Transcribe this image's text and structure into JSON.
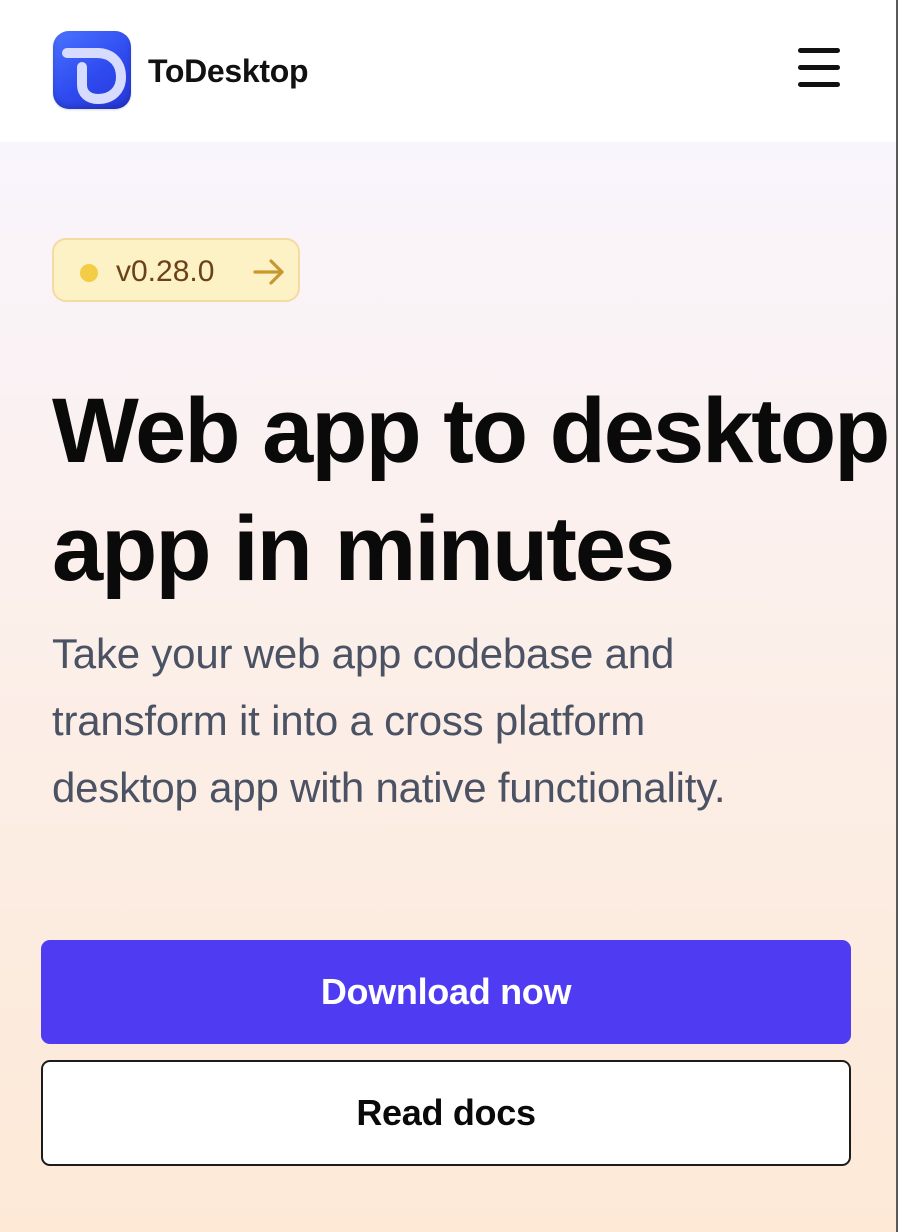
{
  "header": {
    "brand_name": "ToDesktop",
    "logo_icon": "todesktop-logo-icon",
    "menu_icon": "hamburger-menu-icon"
  },
  "badge": {
    "version": "v0.28.0",
    "arrow_icon": "arrow-right-icon"
  },
  "hero": {
    "headline_line1": "Web app to desktop",
    "headline_line2": "app in minutes",
    "subheading_line1": "Take your web app codebase and",
    "subheading_line2": "transform it into a cross platform",
    "subheading_line3": "desktop app with native functionality."
  },
  "actions": {
    "primary_label": "Download now",
    "secondary_label": "Read docs"
  },
  "colors": {
    "accent": "#4f3bf2",
    "badge_bg": "#fdf1c6",
    "badge_dot": "#f2cd45",
    "badge_text": "#6b4217",
    "heading": "#0a0a0a",
    "subtext": "#4a5263"
  }
}
